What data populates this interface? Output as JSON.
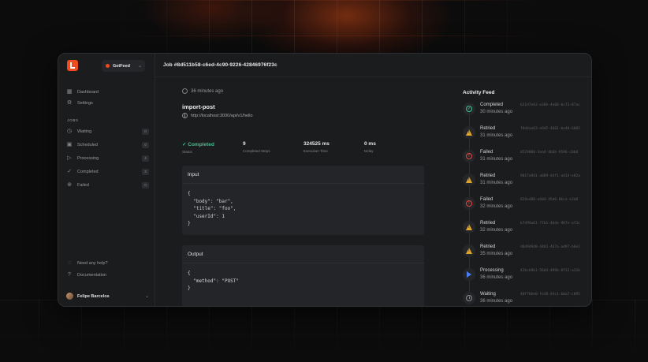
{
  "header": {
    "title": "Job #8d511b58-c6ed-4c90-9226-42846976f23c"
  },
  "sidebar": {
    "project": {
      "name": "GetFeed"
    },
    "top_items": [
      {
        "label": "Dashboard",
        "icon": "grid-icon"
      },
      {
        "label": "Settings",
        "icon": "gear-icon"
      }
    ],
    "jobs_section_label": "JOBS",
    "job_items": [
      {
        "label": "Waiting",
        "count": "0",
        "icon": "clock-icon"
      },
      {
        "label": "Scheduled",
        "count": "0",
        "icon": "calendar-icon"
      },
      {
        "label": "Processing",
        "count": "4",
        "icon": "play-icon"
      },
      {
        "label": "Completed",
        "count": "3",
        "icon": "check-icon"
      },
      {
        "label": "Failed",
        "count": "0",
        "icon": "x-circle-icon"
      }
    ],
    "bottom_items": [
      {
        "label": "Need any help?",
        "icon": "help-icon"
      },
      {
        "label": "Documentation",
        "icon": "doc-icon"
      }
    ],
    "user": {
      "name": "Felipe Barcelos"
    }
  },
  "job": {
    "time_ago": "36 minutes ago",
    "name": "import-post",
    "url": "http://localhost:3000/api/v1/hello",
    "stats": {
      "status": {
        "value": "Completed",
        "label": "Status"
      },
      "steps": {
        "value": "9",
        "label": "Completed Steps"
      },
      "exec": {
        "value": "324525 ms",
        "label": "Execution Time"
      },
      "delay": {
        "value": "0 ms",
        "label": "Delay"
      }
    },
    "input": {
      "title": "Input",
      "code": "{\n  \"body\": \"bar\",\n  \"title\": \"foo\",\n  \"userId\": 1\n}"
    },
    "output": {
      "title": "Output",
      "code": "{\n  \"method\": \"POST\"\n}"
    }
  },
  "feed": {
    "title": "Activity Feed",
    "items": [
      {
        "status": "Completed",
        "time": "30 minutes ago",
        "id": "b21d7e63-e28b-4a68-bc73-07ac",
        "kind": "completed"
      },
      {
        "status": "Retried",
        "time": "31 minutes ago",
        "id": "f0d4aa63-e6d5-4601-be48-6082",
        "kind": "retried"
      },
      {
        "status": "Failed",
        "time": "31 minutes ago",
        "id": "0529008-3ea4-4b6b-9596-c0b0",
        "kind": "failed"
      },
      {
        "status": "Retried",
        "time": "31 minutes ago",
        "id": "9017a9d1-a089-4df1-ad14-e02a",
        "kind": "retried"
      },
      {
        "status": "Failed",
        "time": "32 minutes ago",
        "id": "829ed80-e604-45d6-86ca-e3d8",
        "kind": "failed"
      },
      {
        "status": "Retried",
        "time": "32 minutes ago",
        "id": "b7d99a61-77b1-4bde-907e-af3c",
        "kind": "retried"
      },
      {
        "status": "Retried",
        "time": "35 minutes ago",
        "id": "d6d9d9d0-4461-467a-ad97-b6e1",
        "kind": "retried"
      },
      {
        "status": "Processing",
        "time": "36 minutes ago",
        "id": "42bcb9b1-56d4-499b-8f13-a31b",
        "kind": "processing"
      },
      {
        "status": "Waiting",
        "time": "36 minutes ago",
        "id": "40f7b6e0-fe38-44c1-b0a7-c095",
        "kind": "waiting"
      }
    ]
  },
  "colors": {
    "accent": "#ee4b1f",
    "success": "#3ec28a",
    "warning": "#e0a52a",
    "danger": "#e04a3f",
    "info": "#4a7ef0"
  }
}
